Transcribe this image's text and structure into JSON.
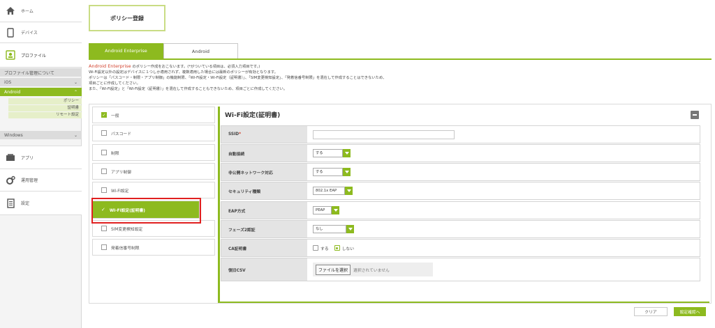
{
  "sidebar": {
    "home": "ホーム",
    "devices": "デバイス",
    "profile": "プロファイル",
    "profile_manage": "プロファイル管理について",
    "ios": "iOS",
    "android": "Android",
    "android_children": [
      "ポリシー",
      "証明書",
      "リモート設定"
    ],
    "windows": "Windows",
    "apps": "アプリ",
    "operations": "運用管理",
    "settings": "設定",
    "icons": [
      "home-icon",
      "device-icon",
      "profile-icon",
      "app-icon",
      "gear-icon",
      "document-icon"
    ]
  },
  "page": {
    "title": "ポリシー登録"
  },
  "tabs": [
    "Android Enterprise",
    "Android"
  ],
  "description": {
    "brand": "Android Enterprise",
    "line1_rest": " のポリシー作成をおこないます。(*がついている項目は、必須入力項目です。)",
    "line2": "Wi-Fi設定以外の設定はデバイスに１つしか適用されず、複数適用した場合には最新のポリシーが有効となります。",
    "line3": "ポリシーは「パスコード・制限・アプリ制御」の機能制限、「Wi-Fi設定・Wi-Fi設定（証明書）」、「SIM変更検知設定」、「発着信番号制限」を混在して作成することはできないため、",
    "line4": "項目ごとに作成してください。",
    "line5": "また、「Wi-Fi設定」と「Wi-Fi設定（証明書）」を混在して作成することもできないため、項目ごとに作成してください。"
  },
  "menu": [
    {
      "label": "一般",
      "state": "checked"
    },
    {
      "label": "パスコード",
      "state": "unchecked"
    },
    {
      "label": "制限",
      "state": "unchecked"
    },
    {
      "label": "アプリ制御",
      "state": "unchecked"
    },
    {
      "label": "Wi-Fi設定",
      "state": "unchecked"
    },
    {
      "label": "Wi-Fi設定(証明書)",
      "state": "selected"
    },
    {
      "label": "SIM変更検知設定",
      "state": "unchecked"
    },
    {
      "label": "発着信番号制限",
      "state": "unchecked"
    }
  ],
  "form": {
    "title": "Wi-Fi設定(証明書)",
    "ssid_label": "SSID",
    "ssid_required_mark": "*",
    "ssid_value": "",
    "auto_connect_label": "自動接続",
    "auto_connect_value": "する",
    "hidden_network_label": "非公開ネットワーク対応",
    "hidden_network_value": "する",
    "security_label": "セキュリティ種類",
    "security_value": "802.1x EAP",
    "eap_label": "EAP方式",
    "eap_value": "PEAP",
    "phase2_label": "フェーズ2認証",
    "phase2_value": "なし",
    "ca_label": "CA証明書",
    "ca_option_yes": "する",
    "ca_option_no": "しない",
    "ca_selected": "しない",
    "csv_label": "復旧CSV",
    "file_button": "ファイルを選択",
    "file_status": "選択されていません"
  },
  "buttons": {
    "clear": "クリア",
    "confirm": "設定確認へ"
  },
  "colors": {
    "accent": "#8dba1f",
    "highlight": "#e02020",
    "brand_text": "#d2422e"
  }
}
